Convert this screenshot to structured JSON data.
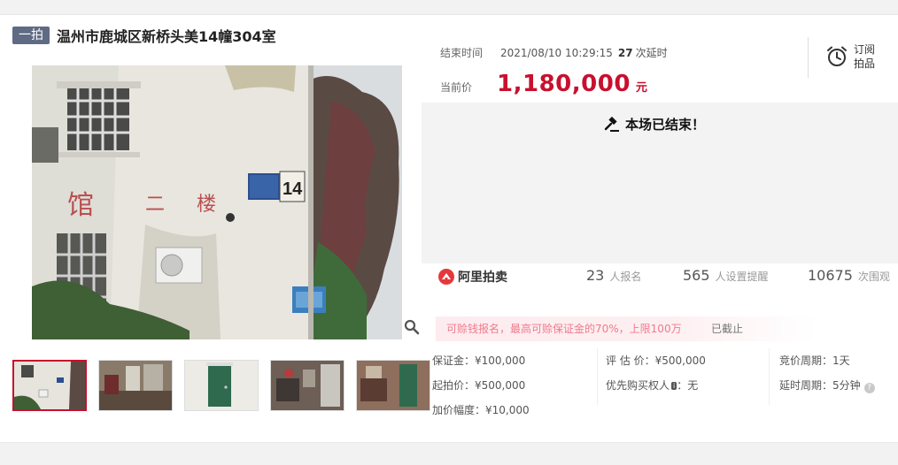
{
  "header": {
    "badge": "一拍",
    "title": "温州市鹿城区新桥头美14幢304室"
  },
  "auction": {
    "end_label": "结束时间",
    "end_time": "2021/08/10 10:29:15",
    "delay_count": "27",
    "delay_unit": "次延时",
    "price_label": "当前价",
    "price": "1,180,000",
    "price_unit": "元",
    "subscribe_line1": "订阅",
    "subscribe_line2": "拍品",
    "ended_text": "本场已结束！"
  },
  "photo": {
    "wall_sign": "14",
    "wall_chars": [
      "馆",
      "二",
      "楼"
    ]
  },
  "stats": {
    "platform": "阿里拍卖",
    "signup_count": "23",
    "signup_unit": "人报名",
    "reminder_count": "565",
    "reminder_unit": "人设置提醒",
    "view_count": "10675",
    "view_unit": "次围观"
  },
  "notice": {
    "text": "可赊钱报名，最高可赊保证金的70%，上限100万",
    "status": "已截止"
  },
  "details": {
    "deposit": "保证金：¥100,000",
    "start_price": "起拍价：¥500,000",
    "increment": "加价幅度：¥10,000",
    "appraisal": "评 估 价：¥500,000",
    "priority_buyer_label": "优先购买权人",
    "priority_buyer_value": "：无",
    "bid_cycle": "竞价周期：1天",
    "delay_cycle": "延时周期：5分钟"
  },
  "colors": {
    "accent_red": "#c8102e",
    "badge_gray": "#5f6b84"
  }
}
